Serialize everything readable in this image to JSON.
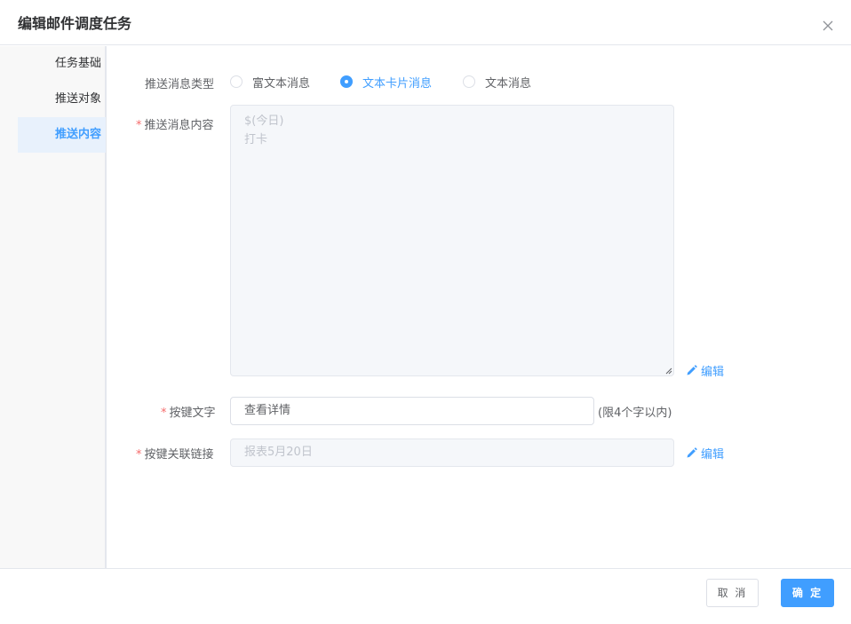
{
  "dialog": {
    "title": "编辑邮件调度任务"
  },
  "sidebar": {
    "items": [
      {
        "label": "任务基础"
      },
      {
        "label": "推送对象"
      },
      {
        "label": "推送内容"
      }
    ],
    "active_index": 2
  },
  "form": {
    "message_type": {
      "label": "推送消息类型",
      "options": [
        "富文本消息",
        "文本卡片消息",
        "文本消息"
      ],
      "selected": "文本卡片消息"
    },
    "message_content": {
      "required_mark": "*",
      "label": "推送消息内容",
      "lines": [
        "$(今日)",
        "打卡"
      ],
      "edit_label": "编辑"
    },
    "button_text": {
      "required_mark": "*",
      "label": "按键文字",
      "value": "查看详情",
      "hint": "(限4个字以内)"
    },
    "button_link": {
      "required_mark": "*",
      "label": "按键关联链接",
      "value": "报表5月20日",
      "edit_label": "编辑"
    }
  },
  "footer": {
    "cancel_label": "取 消",
    "confirm_label": "确 定"
  },
  "colors": {
    "accent": "#409eff",
    "required": "#f56c6c",
    "disabled_bg": "#f5f7fa",
    "active_nav_bg": "#e8f1fc"
  },
  "icons": [
    "close-icon",
    "pencil-icon"
  ]
}
